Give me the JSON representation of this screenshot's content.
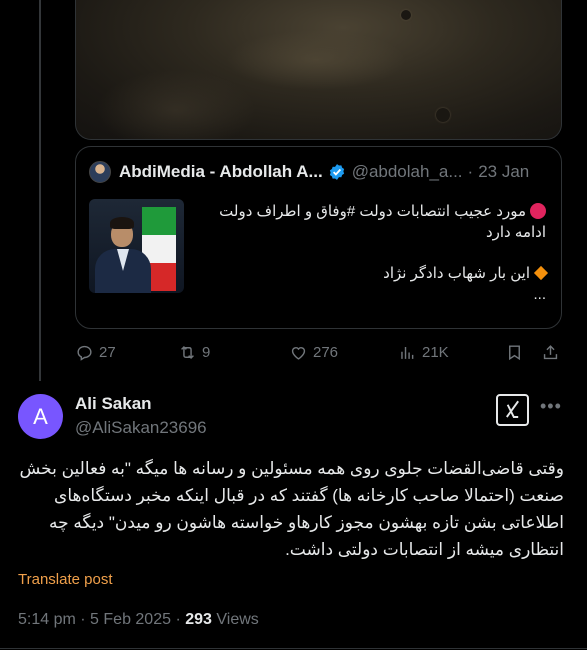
{
  "quoted_post": {
    "author_name": "AbdiMedia - Abdollah A...",
    "author_handle": "@abdolah_a...",
    "separator": "·",
    "date": "23 Jan",
    "text_line1": "مورد عجیب انتصابات دولت #وفاق و اطراف دولت",
    "text_line2": "ادامه دارد",
    "text_line3": "این بار شهاب دادگر نژاد",
    "text_more": "..."
  },
  "actions": {
    "replies": "27",
    "reposts": "9",
    "likes": "276",
    "views": "21K"
  },
  "post": {
    "avatar_letter": "A",
    "author_name": "Ali Sakan",
    "author_handle": "@AliSakan23696",
    "text": "وقتی قاضی‌القضات جلوی روی همه مسئولین و رسانه ها میگه \"به فعالین بخش صنعت (احتمالا صاحب کارخانه ها) گفتند که در قبال اینکه مخبر دستگاه‌های اطلاعاتی بشن تازه بهشون مجوز کارهاو خواسته هاشون رو میدن\" دیگه چه انتظاری میشه از انتصابات دولتی داشت.",
    "translate_label": "Translate post",
    "time": "5:14 pm",
    "date": "5 Feb 2025",
    "separator": "·",
    "views_count": "293",
    "views_label": "Views"
  },
  "colors": {
    "background": "#000000",
    "text_primary": "#e7e9ea",
    "text_secondary": "#71767b",
    "verified": "#1d9bf0",
    "avatar": "#7856ff",
    "translate": "#f0a04b"
  }
}
